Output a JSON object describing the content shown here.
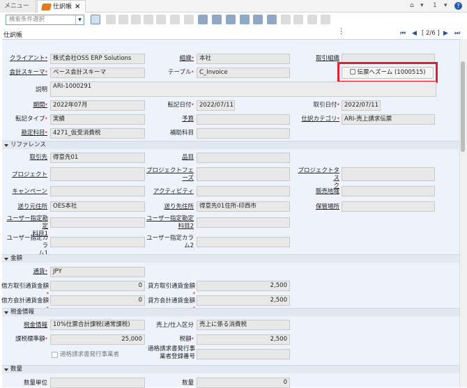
{
  "tabs": {
    "menu": "メニュー",
    "active": "仕訳帳",
    "close": "×"
  },
  "topright": {
    "count": "1"
  },
  "search": {
    "placeholder": "検索条件選択"
  },
  "page_title": "仕訳帳",
  "record_nav": "[ 2/6 ]",
  "fields": {
    "client_label": "クライアント",
    "client": "株式会社OSS ERP Solutions",
    "org_label": "組織",
    "org": "本社",
    "trxorg_label": "取引組織",
    "trxorg": "",
    "schema_label": "会計スキーマ",
    "schema": "ベース会計スキーマ",
    "table_label": "テーブル",
    "table": "C_Invoice",
    "zoom_button": "伝票へズーム (1000515)",
    "desc_label": "説明",
    "desc": "ARI-1000291",
    "period_label": "期間",
    "period": "2022年07月",
    "dateacct_label": "転記日付",
    "dateacct": "2022/07/11",
    "datetrx_label": "取引日付",
    "datetrx": "2022/07/11",
    "posttype_label": "転記タイプ",
    "posttype": "実績",
    "budget_label": "予算",
    "budget": "",
    "glcat_label": "仕訳カテゴリ",
    "glcat": "ARI-売上請求伝票",
    "account_label": "勘定科目",
    "account": "4271_仮受消費税",
    "subacct_label": "補助科目",
    "subacct": ""
  },
  "sections": {
    "ref": "リファレンス",
    "amount": "金額",
    "tax": "税金情報",
    "qty": "数量"
  },
  "ref": {
    "bp_label": "取引先",
    "bp": "得意先01",
    "product_label": "品目",
    "product": "",
    "project_label": "プロジェクト",
    "project": "",
    "phase_label1": "プロジェクトフェ",
    "phase_label2": "ーズ",
    "phase": "",
    "task_label1": "プロジェクトタス",
    "task_label2": "ク",
    "task": "",
    "campaign_label": "キャンペーン",
    "campaign": "",
    "activity_label": "アクティビティ",
    "activity": "",
    "region_label": "販売地域",
    "region": "",
    "locfrom_label": "送り元住所",
    "locfrom": "OES本社",
    "locto_label": "送り先住所",
    "locto": "得意先01住所-印西市",
    "warehouse_label": "保管場所",
    "warehouse": "",
    "ue1_label1": "ユーザー指定勘定",
    "ue1_label2": "科目1",
    "ue1": "",
    "ue2_label1": "ユーザー指定勘定",
    "ue2_label2": "科目2",
    "ue2": "",
    "uc1_label1": "ユーザー指定カラ",
    "uc1_label2": "ム1",
    "uc1": "",
    "uc2_label1": "ユーザー指定カラ",
    "uc2_label2": "ム2",
    "uc2": ""
  },
  "amount": {
    "currency_label": "通貨",
    "currency": "JPY",
    "amtsrcdr_label": "借方取引通貨金額",
    "amtsrcdr": "0",
    "amtsrccr_label": "貸方取引通貨金額",
    "amtsrccr": "2,500",
    "amtacctdr_label": "借方会計通貨金額",
    "amtacctdr": "0",
    "amtacctcr_label": "貸方会計通貨金額",
    "amtacctcr": "2,500"
  },
  "tax": {
    "taxinfo_label": "税金情報",
    "taxinfo": "10%仕票合計課税(通常課税)",
    "salespur_label": "売上/仕入区分",
    "salespur": "売上に係る消費税",
    "taxbase_label": "課税標準額",
    "taxbase": "25,000",
    "taxamt_label": "税額",
    "taxamt": "2,500",
    "qualified_label": "適格請求書発行事業者",
    "regno_label1": "適格請求書発行事",
    "regno_label2": "業者登録番号",
    "regno": ""
  },
  "qty": {
    "uom_label": "数量単位",
    "uom": "",
    "qty_label": "数量",
    "qty": "0"
  }
}
